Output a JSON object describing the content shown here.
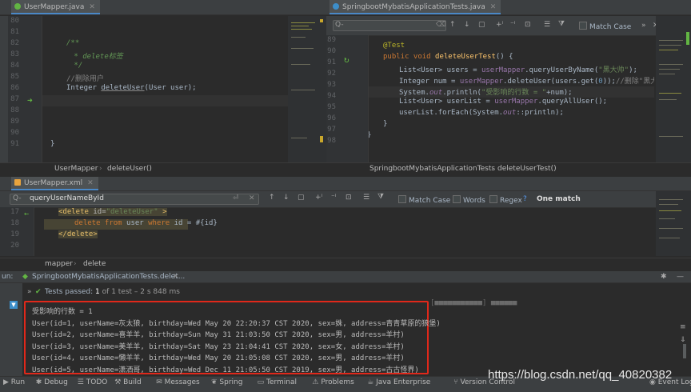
{
  "left_editor": {
    "tab": "UserMapper.java",
    "line_numbers": [
      "80",
      "81",
      "82",
      "83",
      "84",
      "85",
      "86",
      "87",
      "88",
      "89",
      "90",
      "91"
    ],
    "lines": [
      {
        "parts": []
      },
      {
        "parts": []
      },
      {
        "parts": [
          {
            "t": "/**",
            "c": "cm"
          }
        ]
      },
      {
        "parts": [
          {
            "t": " * delete标签",
            "c": "cm"
          }
        ]
      },
      {
        "parts": [
          {
            "t": " */",
            "c": "cm"
          }
        ]
      },
      {
        "parts": [
          {
            "t": "//删除用户",
            "c": "cmg"
          }
        ]
      },
      {
        "parts": [
          {
            "t": "Integer ",
            "c": ""
          },
          {
            "t": "deleteUser",
            "c": "u"
          },
          {
            "t": "(User user);",
            "c": ""
          }
        ]
      },
      {
        "parts": []
      },
      {
        "parts": []
      },
      {
        "parts": []
      },
      {
        "parts": []
      },
      {
        "parts": [
          {
            "t": "}",
            "c": ""
          }
        ]
      }
    ],
    "breadcrumb": [
      "UserMapper",
      "deleteUser()"
    ]
  },
  "right_editor": {
    "tab": "SpringbootMybatisApplicationTests.java",
    "search_placeholder": "Q-",
    "match_case_label": "Match Case",
    "line_numbers": [
      "89",
      "90",
      "91",
      "92",
      "93",
      "94",
      "95",
      "96",
      "97",
      "98"
    ],
    "lines": [
      {
        "parts": [
          {
            "t": "@Test",
            "c": "ann"
          }
        ]
      },
      {
        "parts": [
          {
            "t": "public void ",
            "c": "kw"
          },
          {
            "t": "deleteUserTest",
            "c": "fn"
          },
          {
            "t": "() {",
            "c": ""
          }
        ]
      },
      {
        "parts": [
          {
            "t": "List<User> users = ",
            "c": ""
          },
          {
            "t": "userMapper",
            "c": "fld"
          },
          {
            "t": ".queryUserByName(",
            "c": ""
          },
          {
            "t": "\"黑大帅\"",
            "c": "str"
          },
          {
            "t": ");",
            "c": ""
          }
        ]
      },
      {
        "parts": [
          {
            "t": "Integer num = ",
            "c": ""
          },
          {
            "t": "userMapper",
            "c": "fld"
          },
          {
            "t": ".deleteUser(users.get(",
            "c": ""
          },
          {
            "t": "0",
            "c": "num"
          },
          {
            "t": "));",
            "c": ""
          },
          {
            "t": "//删除\"黑大帅\"",
            "c": "cmg"
          }
        ]
      },
      {
        "parts": [
          {
            "t": "System.",
            "c": ""
          },
          {
            "t": "out",
            "c": "fldi"
          },
          {
            "t": ".println(",
            "c": ""
          },
          {
            "t": "\"受影响的行数 = \"",
            "c": "str"
          },
          {
            "t": "+num);",
            "c": ""
          }
        ]
      },
      {
        "parts": [
          {
            "t": "List<User> userList = ",
            "c": ""
          },
          {
            "t": "userMapper",
            "c": "fld"
          },
          {
            "t": ".queryAllUser();",
            "c": ""
          }
        ]
      },
      {
        "parts": [
          {
            "t": "userList.forEach(System.",
            "c": ""
          },
          {
            "t": "out",
            "c": "fldi"
          },
          {
            "t": "::println);",
            "c": ""
          }
        ]
      },
      {
        "parts": [
          {
            "t": "}",
            "c": ""
          }
        ]
      },
      {
        "parts": [
          {
            "t": "}",
            "c": ""
          }
        ]
      },
      {
        "parts": []
      }
    ],
    "indent": [
      1,
      1,
      2,
      2,
      2,
      2,
      2,
      1,
      0,
      0
    ],
    "breadcrumb": [
      "SpringbootMybatisApplicationTests",
      "deleteUserTest()"
    ]
  },
  "xml_editor": {
    "tab": "UserMapper.xml",
    "search_value": "queryUserNameById",
    "match_case_label": "Match Case",
    "words_label": "Words",
    "regex_label": "Regex",
    "regex_help": "?",
    "match_count": "One match",
    "line_numbers": [
      "17",
      "18",
      "19",
      "20"
    ],
    "breadcrumb": [
      "mapper",
      "delete"
    ]
  },
  "run_panel": {
    "title_prefix": "un:",
    "config_name": "SpringbootMybatisApplicationTests.delet...",
    "status_prefix": "Tests passed:",
    "status_count": "1",
    "status_rest": "of 1 test – 2 s 848 ms",
    "console_lines": [
      "受影响的行数 = 1",
      "User(id=1, userName=灰太狼, birthday=Wed May 20 22:20:37 CST 2020, sex=姝, address=青青草原的狼堡)",
      "User(id=2, userName=喜羊羊, birthday=Sun May 31 21:03:50 CST 2020, sex=男, address=羊村)",
      "User(id=3, userName=美羊羊, birthday=Sat May 23 21:04:41 CST 2020, sex=女, address=羊村)",
      "User(id=4, userName=懒羊羊, birthday=Wed May 20 21:05:08 CST 2020, sex=男, address=羊村)",
      "User(id=5, userName=潇洒哥, birthday=Wed Dec 11 21:05:50 CST 2019, sex=男, address=古古怪界)"
    ]
  },
  "bottom_tools": [
    {
      "label": "Run",
      "icon": "play-icon"
    },
    {
      "label": "Debug",
      "icon": "bug-icon"
    },
    {
      "label": "TODO",
      "icon": "todo-icon"
    },
    {
      "label": "Build",
      "icon": "hammer-icon"
    },
    {
      "label": "Messages",
      "icon": "messages-icon"
    },
    {
      "label": "Spring",
      "icon": "leaf-icon"
    },
    {
      "label": "Terminal",
      "icon": "terminal-icon"
    },
    {
      "label": "Problems",
      "icon": "warning-icon"
    },
    {
      "label": "Java Enterprise",
      "icon": "java-ee-icon"
    },
    {
      "label": "Version Control",
      "icon": "vcs-icon"
    }
  ],
  "event_log": "Event Log",
  "watermark": "https://blog.csdn.net/qq_40820382",
  "colors": {
    "highlight_border": "#e0281a",
    "tab_underline": "#4a88c7",
    "pass_green": "#62b543"
  }
}
